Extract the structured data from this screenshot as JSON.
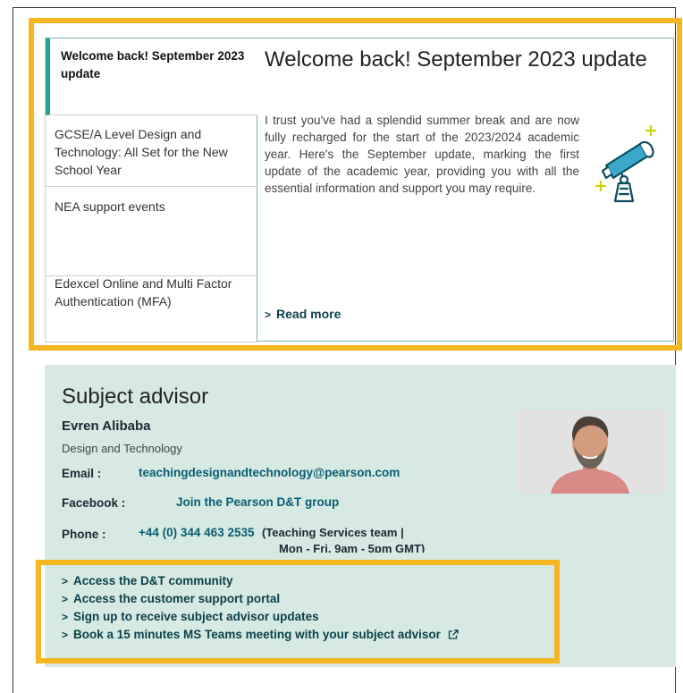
{
  "news": {
    "tabs": [
      {
        "label": "Welcome back! September 2023 update"
      },
      {
        "label": "GCSE/A Level Design and Technology: All Set for the New School Year"
      },
      {
        "label": "NEA support events"
      },
      {
        "label": "Edexcel Online and Multi Factor Authentication (MFA)"
      }
    ],
    "title": "Welcome back! September 2023 update",
    "body": "I trust you've had a splendid summer break and are now fully recharged for the start of the 2023/2024 academic year. Here's the September update, marking the first update of the academic year, providing you with all the essential information and support you may require.",
    "read_more": "Read more",
    "icon": "telescope-icon"
  },
  "advisor": {
    "title": "Subject advisor",
    "name": "Evren Alibaba",
    "subject": "Design and Technology",
    "email_label": "Email :",
    "email": "teachingdesignandtechnology@pearson.com",
    "facebook_label": "Facebook :",
    "facebook": "Join the Pearson D&T group",
    "phone_label": "Phone :",
    "phone": "+44 (0) 344 463 2535",
    "phone_note_1": "(Teaching Services team |",
    "phone_note_2": "Mon - Fri, 9am - 5pm GMT)",
    "links": [
      {
        "label": "Access the D&T community"
      },
      {
        "label": "Access the customer support portal"
      },
      {
        "label": "Sign up to receive subject advisor updates"
      },
      {
        "label": "Book a 15 minutes MS Teams meeting with your subject advisor"
      }
    ]
  },
  "colors": {
    "highlight": "#f5b621",
    "accent": "#1fa29a",
    "advisor_bg": "#d6eae3",
    "link": "#0a5c73"
  }
}
